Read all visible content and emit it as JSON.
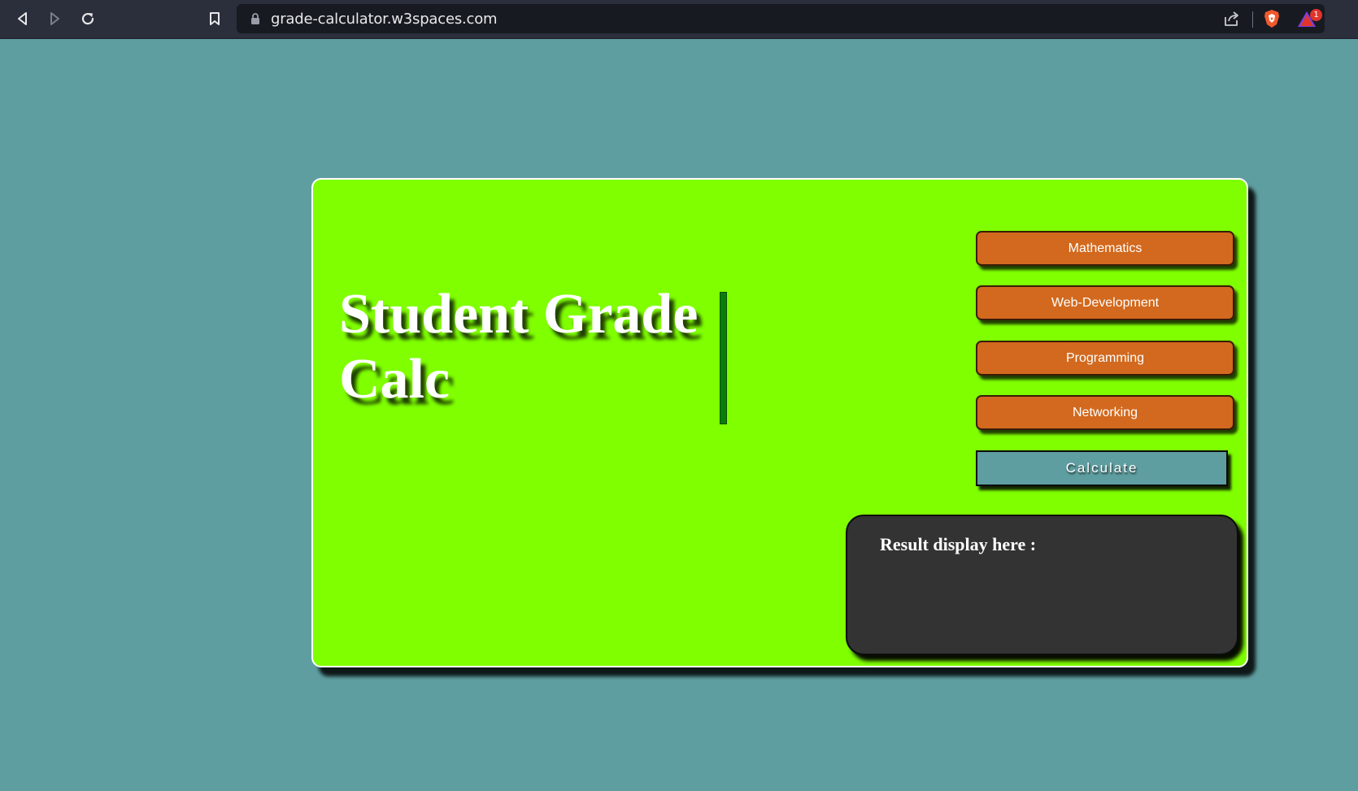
{
  "browser": {
    "url": "grade-calculator.w3spaces.com",
    "rewards_badge": "1",
    "icons": [
      "back-icon",
      "forward-icon",
      "reload-icon",
      "bookmark-icon",
      "lock-icon",
      "share-icon",
      "brave-shields-icon",
      "brave-rewards-icon"
    ]
  },
  "page": {
    "title": "Student Grade Calc",
    "subjects": [
      {
        "label": "Mathematics"
      },
      {
        "label": "Web-Development"
      },
      {
        "label": "Programming"
      },
      {
        "label": "Networking"
      }
    ],
    "calculate_label": "Calculate",
    "result_label": "Result display here :"
  },
  "colors": {
    "page_background": "#5f9ea0",
    "card_background": "#7fff00",
    "subject_button": "#d2691e",
    "calculate_button": "#5f9ea0",
    "result_panel": "#333333",
    "divider": "#0a7d0a"
  }
}
